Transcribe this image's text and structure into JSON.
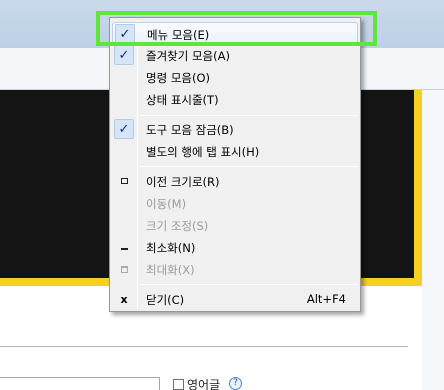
{
  "menu": {
    "items": [
      {
        "label": "메뉴 모음(E)",
        "checked": true,
        "disabled": false,
        "icon": "checkmark-icon"
      },
      {
        "label": "즐겨찾기 모음(A)",
        "checked": true,
        "disabled": false,
        "icon": "checkmark-icon"
      },
      {
        "label": "명령 모음(O)",
        "checked": false,
        "disabled": false,
        "icon": ""
      },
      {
        "label": "상태 표시줄(T)",
        "checked": false,
        "disabled": false,
        "icon": ""
      },
      {
        "label": "도구 모음 잠금(B)",
        "checked": true,
        "disabled": false,
        "icon": "checkmark-icon"
      },
      {
        "label": "별도의 행에 탭 표시(H)",
        "checked": false,
        "disabled": false,
        "icon": ""
      },
      {
        "label": "이전 크기로(R)",
        "checked": false,
        "disabled": false,
        "icon": "restore-icon"
      },
      {
        "label": "이동(M)",
        "checked": false,
        "disabled": true,
        "icon": ""
      },
      {
        "label": "크기 조정(S)",
        "checked": false,
        "disabled": true,
        "icon": ""
      },
      {
        "label": "최소화(N)",
        "checked": false,
        "disabled": false,
        "icon": "minimize-icon"
      },
      {
        "label": "최대화(X)",
        "checked": false,
        "disabled": true,
        "icon": "maximize-icon"
      },
      {
        "label": "닫기(C)",
        "checked": false,
        "disabled": false,
        "icon": "close-icon",
        "shortcut": "Alt+F4"
      }
    ]
  },
  "background": {
    "english_checkbox_label": "영어글",
    "help_glyph": "?"
  },
  "colors": {
    "annotation": "#5ee63d",
    "accent_yellow": "#f2d024",
    "check_bg": "#d6e5f5"
  }
}
